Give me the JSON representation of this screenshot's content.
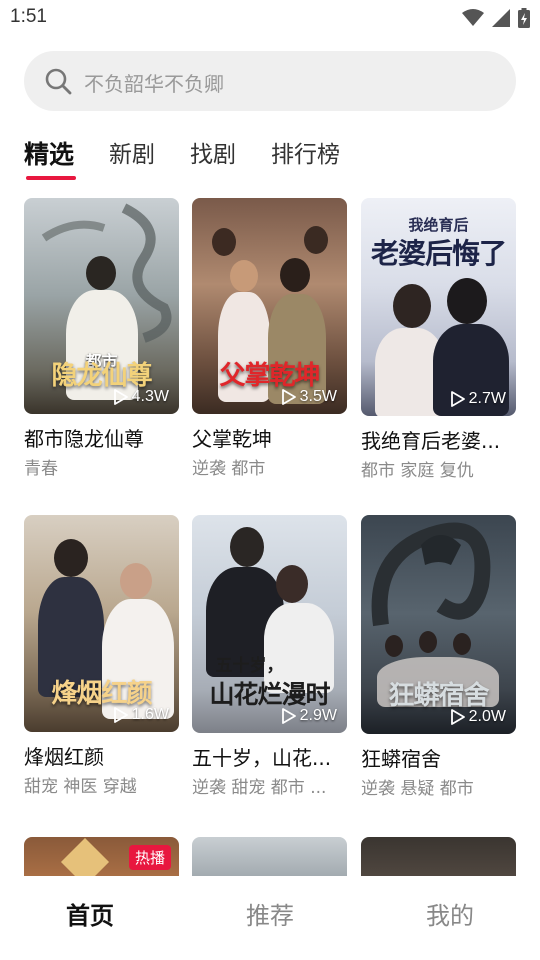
{
  "status_bar": {
    "time": "1:51"
  },
  "search": {
    "placeholder": "不负韶华不负卿"
  },
  "tabs": [
    {
      "label": "精选",
      "active": true
    },
    {
      "label": "新剧"
    },
    {
      "label": "找剧"
    },
    {
      "label": "排行榜"
    }
  ],
  "dramas": [
    {
      "title": "都市隐龙仙尊",
      "tags": "青春",
      "plays": "4.3W",
      "poster_text": "隐龙仙尊",
      "poster_small": "都市"
    },
    {
      "title": "父掌乾坤",
      "tags": "逆袭 都市",
      "plays": "3.5W",
      "poster_text": "父掌乾坤"
    },
    {
      "title": "我绝育后老婆...",
      "tags": "都市 家庭 复仇",
      "plays": "2.7W",
      "poster_small": "我绝育后",
      "poster_text": "老婆后悔了"
    },
    {
      "title": "烽烟红颜",
      "tags": "甜宠 神医 穿越",
      "plays": "1.6W",
      "poster_text": "烽烟红颜"
    },
    {
      "title": "五十岁，山花...",
      "tags": "逆袭 甜宠 都市 ...",
      "plays": "2.9W",
      "poster_small": "五十岁，",
      "poster_text": "山花烂漫时"
    },
    {
      "title": "狂蟒宿舍",
      "tags": "逆袭 悬疑 都市",
      "plays": "2.0W",
      "poster_text": "狂蟒宿舍"
    }
  ],
  "partial_row": {
    "badge": "热播"
  },
  "bottom_nav": [
    {
      "label": "首页",
      "active": true
    },
    {
      "label": "推荐"
    },
    {
      "label": "我的"
    }
  ],
  "colors": {
    "accent": "#e8173f",
    "search_bg": "#efefef",
    "tag_text": "#8a8a8a"
  }
}
